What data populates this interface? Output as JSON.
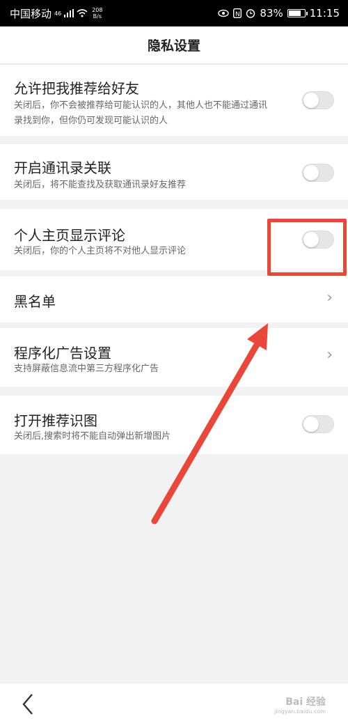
{
  "status": {
    "carrier": "中国移动",
    "network": "46",
    "speed_value": "208",
    "speed_unit": "B/s",
    "battery": "83%",
    "time": "11:15",
    "battery_level": 0.83
  },
  "header": {
    "title": "隐私设置"
  },
  "settings": [
    {
      "title": "允许把我推荐给好友",
      "desc": "关闭后，你不会被推荐给可能认识的人，其他人也不能通过通讯录找到你，但你仍可发现可能认识的人",
      "control": "toggle",
      "on": false
    },
    {
      "title": "开启通讯录关联",
      "desc": "关闭后，将不能查找及获取通讯录好友推荐",
      "control": "toggle",
      "on": false
    },
    {
      "title": "个人主页显示评论",
      "desc": "关闭后，你的个人主页将不对他人显示评论",
      "control": "toggle",
      "on": false
    },
    {
      "title": "黑名单",
      "desc": "",
      "control": "chevron"
    },
    {
      "title": "程序化广告设置",
      "desc": "支持屏蔽信息流中第三方程序化广告",
      "control": "chevron"
    },
    {
      "title": "打开推荐识图",
      "desc": "关闭后,搜索时将不能自动弹出新增图片",
      "control": "toggle",
      "on": false
    }
  ],
  "annotation_color": "#e8473a",
  "nav": {
    "back_icon": "chevron-left-icon"
  },
  "watermark": {
    "text": "Bai 经验",
    "url": "jingyan.baidu.com"
  }
}
